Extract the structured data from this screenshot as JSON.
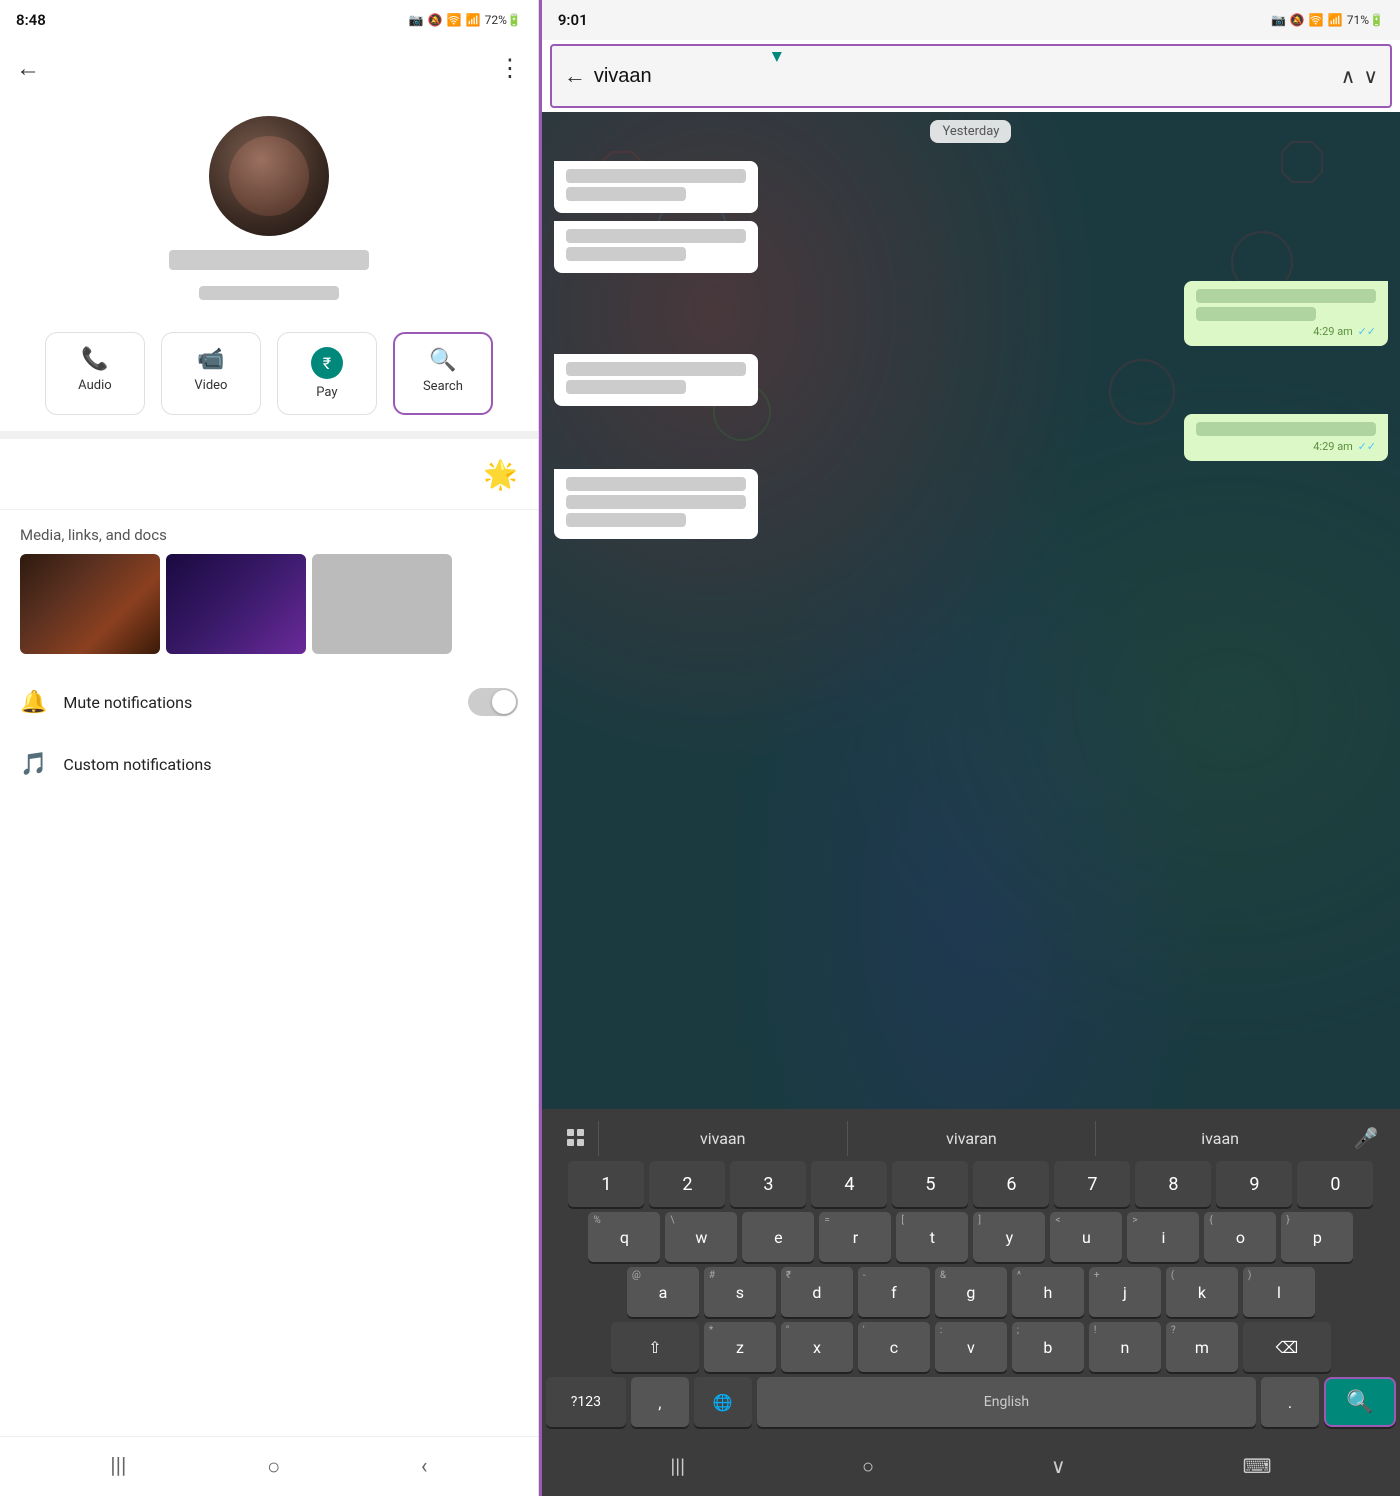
{
  "left": {
    "status_bar": {
      "time": "8:48",
      "icons": "📷 🔕 📶 72%"
    },
    "header": {
      "back_label": "←",
      "more_label": "⋮"
    },
    "profile": {
      "name_placeholder": "",
      "phone_placeholder": ""
    },
    "actions": [
      {
        "id": "audio",
        "icon": "📞",
        "label": "Audio"
      },
      {
        "id": "video",
        "icon": "📹",
        "label": "Video"
      },
      {
        "id": "pay",
        "icon": "₹",
        "label": "Pay"
      },
      {
        "id": "search",
        "icon": "🔍",
        "label": "Search"
      }
    ],
    "media_label": "Media, links, and docs",
    "notifications": [
      {
        "id": "mute",
        "icon": "🔔",
        "label": "Mute notifications"
      },
      {
        "id": "custom",
        "icon": "🎵",
        "label": "Custom notifications"
      }
    ],
    "nav": [
      "|||",
      "○",
      "<"
    ]
  },
  "right": {
    "status_bar": {
      "time": "9:01",
      "icons": "📷 🔕 📶 71%"
    },
    "search_bar": {
      "back_label": "←",
      "query": "vivaan",
      "nav_up": "^",
      "nav_down": "v"
    },
    "chat": {
      "yesterday_label": "Yesterday",
      "messages": [
        {
          "type": "received"
        },
        {
          "type": "received"
        },
        {
          "type": "sent",
          "time": "4:29 am",
          "ticks": "//"
        },
        {
          "type": "sent",
          "time": "4:29 am",
          "ticks": "//"
        }
      ]
    },
    "keyboard": {
      "suggestions": [
        "vivaan",
        "vivaran",
        "ivaan"
      ],
      "rows": [
        [
          "1",
          "2",
          "3",
          "4",
          "5",
          "6",
          "7",
          "8",
          "9",
          "0"
        ],
        [
          "q",
          "w",
          "e",
          "r",
          "t",
          "y",
          "u",
          "i",
          "o",
          "p"
        ],
        [
          "a",
          "s",
          "d",
          "f",
          "g",
          "h",
          "j",
          "k",
          "l"
        ],
        [
          "z",
          "x",
          "c",
          "v",
          "b",
          "n",
          "m"
        ],
        [
          "?123",
          ",",
          "globe",
          "English",
          ".",
          "search"
        ]
      ],
      "secondary": {
        "q": "%",
        "w": "\\",
        "e": "e",
        "r": "=",
        "t": "[",
        "y": "]",
        "u": "<",
        "i": ">",
        "o": "{",
        "p": "}",
        "a": "@",
        "s": "#",
        "d": "₹",
        "f": "-",
        "g": "&",
        "h": "^",
        "j": "+",
        "k": "(",
        "l": ")",
        "z": "*",
        "x": "\"",
        "c": "'",
        "v": ":",
        "b": ";",
        "n": "!",
        "m": "?"
      },
      "search_icon": "🔍",
      "mic_icon": "🎤",
      "shift_icon": "⇧",
      "backspace_icon": "⌫"
    },
    "bottom_nav": [
      "|||",
      "○",
      "v",
      "⌨"
    ]
  }
}
